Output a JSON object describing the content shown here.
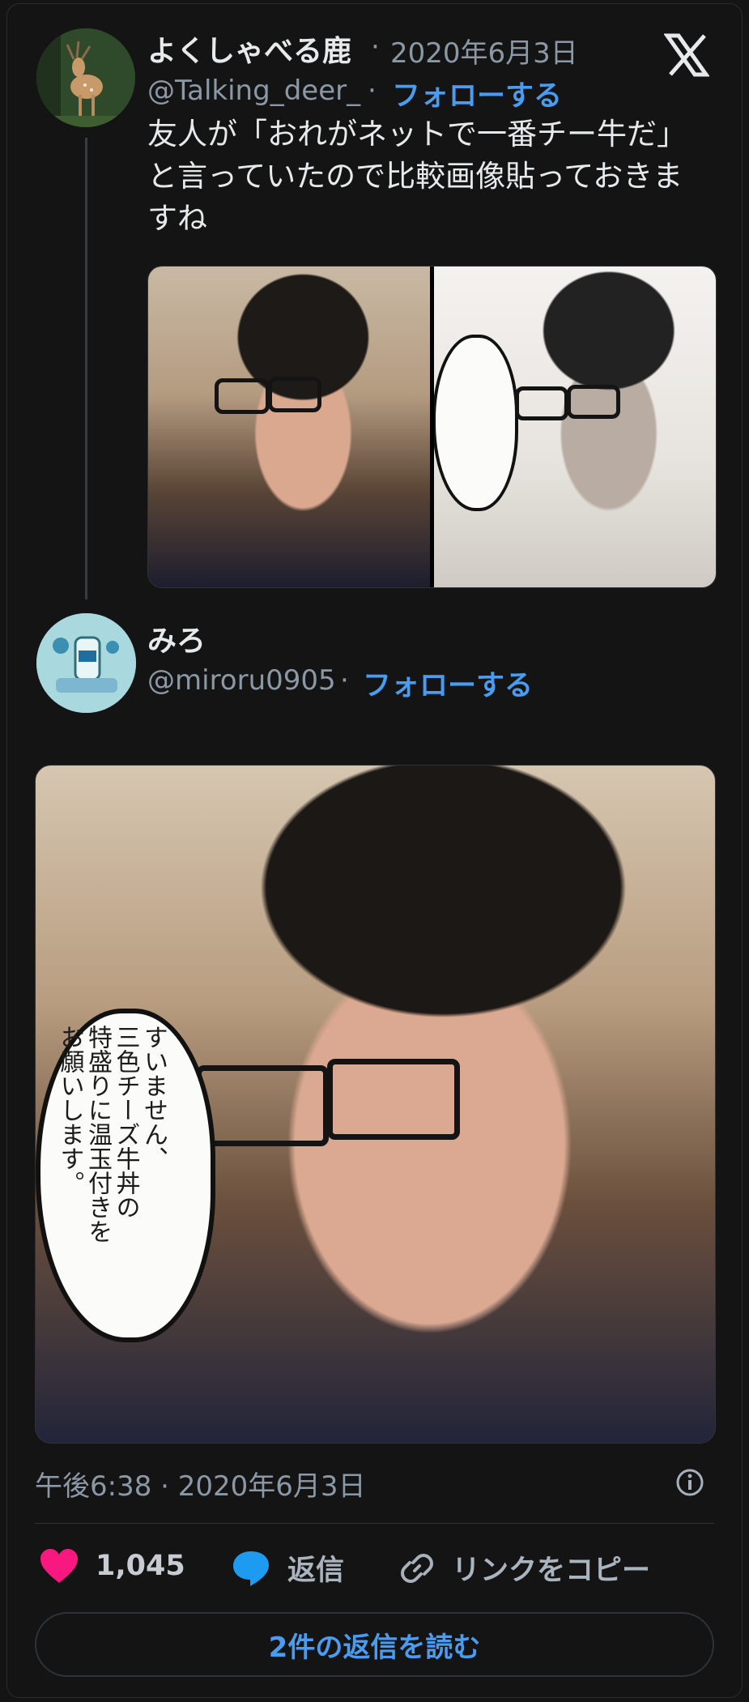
{
  "tweet": {
    "author_name": "よくしゃべる鹿",
    "separator": "·",
    "date": "2020年6月3日",
    "handle": "@Talking_deer_",
    "follow_label": "フォローする",
    "text_lines": [
      "友人が「おれがネットで一番チー牛だ」",
      "と言っていたので比較画像貼っておきま",
      "すね"
    ]
  },
  "reply": {
    "author_name": "みろ",
    "handle": "@miroru0905",
    "separator": "·",
    "follow_label": "フォローする"
  },
  "speech_bubble": {
    "lines": [
      "すいません、",
      "三色チーズ牛丼の",
      "特盛りに温玉付きを",
      "お願いします。"
    ]
  },
  "footer": {
    "timestamp": "午後6:38 · 2020年6月3日",
    "likes_count": "1,045",
    "reply_label": "返信",
    "copy_link_label": "リンクをコピー",
    "read_replies_label": "2件の返信を読む"
  },
  "colors": {
    "background": "#141414",
    "link_blue": "#4a9cf0",
    "like_pink": "#f91880",
    "reply_blue": "#1d9bf0",
    "muted": "#8b98a5"
  },
  "icons": {
    "logo": "x-logo-icon",
    "like": "heart-icon",
    "reply": "speech-bubble-icon",
    "copy": "link-icon",
    "info": "info-icon"
  }
}
